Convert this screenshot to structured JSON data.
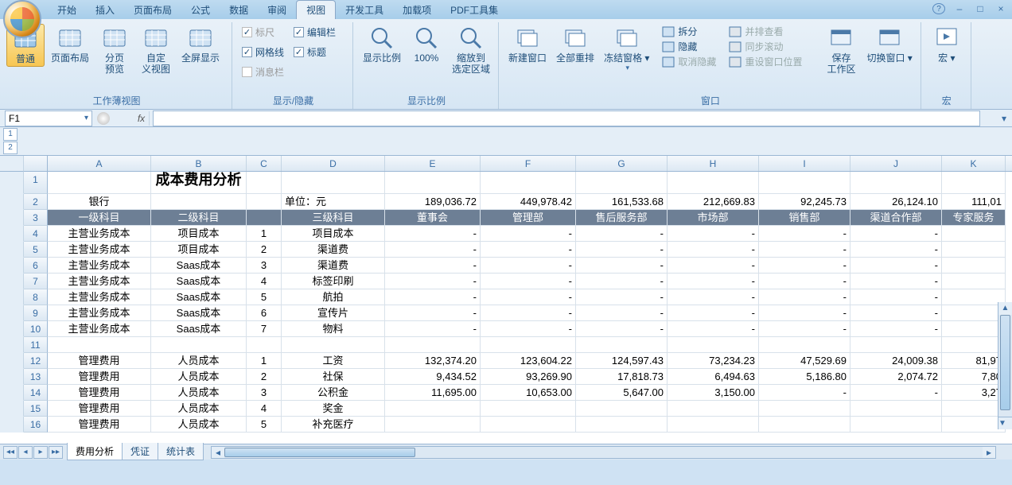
{
  "tabs": [
    "开始",
    "插入",
    "页面布局",
    "公式",
    "数据",
    "审阅",
    "视图",
    "开发工具",
    "加载项",
    "PDF工具集"
  ],
  "active_tab_index": 6,
  "ribbon": {
    "g1": {
      "label": "工作薄视图",
      "btns": [
        "普通",
        "页面布局",
        "分页\n预览",
        "自定\n义视图",
        "全屏显示"
      ]
    },
    "g2": {
      "label": "显示/隐藏",
      "chks": [
        {
          "label": "标尺",
          "checked": true,
          "disabled": true
        },
        {
          "label": "编辑栏",
          "checked": true
        },
        {
          "label": "网格线",
          "checked": true
        },
        {
          "label": "标题",
          "checked": true
        },
        {
          "label": "消息栏",
          "checked": false,
          "disabled": true
        }
      ]
    },
    "g3": {
      "label": "显示比例",
      "btns": [
        "显示比例",
        "100%",
        "缩放到\n选定区域"
      ]
    },
    "g4": {
      "label": "窗口",
      "big": [
        "新建窗口",
        "全部重排",
        "冻结窗格"
      ],
      "small": [
        "拆分",
        "隐藏",
        "取消隐藏",
        "并排查看",
        "同步滚动",
        "重设窗口位置"
      ],
      "right": [
        "保存\n工作区",
        "切换窗口"
      ]
    },
    "g5": {
      "label": "宏",
      "btn": "宏"
    }
  },
  "namebox": "F1",
  "columns": [
    "A",
    "B",
    "C",
    "D",
    "E",
    "F",
    "G",
    "H",
    "I",
    "J",
    "K"
  ],
  "outline_levels": [
    "1",
    "2"
  ],
  "rows": [
    {
      "n": 1,
      "cells": {
        "B": {
          "v": "成本费用分析",
          "cls": "title-cell center"
        }
      }
    },
    {
      "n": 2,
      "cells": {
        "A": {
          "v": "银行",
          "cls": "center"
        },
        "D": {
          "v": "单位：元"
        },
        "E": {
          "v": "189,036.72",
          "cls": "right"
        },
        "F": {
          "v": "449,978.42",
          "cls": "right"
        },
        "G": {
          "v": "161,533.68",
          "cls": "right"
        },
        "H": {
          "v": "212,669.83",
          "cls": "right"
        },
        "I": {
          "v": "92,245.73",
          "cls": "right"
        },
        "J": {
          "v": "26,124.10",
          "cls": "right"
        },
        "K": {
          "v": "111,01",
          "cls": "right"
        }
      }
    },
    {
      "n": 3,
      "hdr": true,
      "cells": {
        "A": {
          "v": "一级科目"
        },
        "B": {
          "v": "二级科目"
        },
        "D": {
          "v": "三级科目"
        },
        "E": {
          "v": "董事会"
        },
        "F": {
          "v": "管理部"
        },
        "G": {
          "v": "售后服务部"
        },
        "H": {
          "v": "市场部"
        },
        "I": {
          "v": "销售部"
        },
        "J": {
          "v": "渠道合作部"
        },
        "K": {
          "v": "专家服务"
        }
      }
    },
    {
      "n": 4,
      "cells": {
        "A": {
          "v": "主营业务成本",
          "cls": "center"
        },
        "B": {
          "v": "项目成本",
          "cls": "center"
        },
        "C": {
          "v": "1",
          "cls": "center"
        },
        "D": {
          "v": "项目成本",
          "cls": "center"
        },
        "E": {
          "v": "-",
          "cls": "right"
        },
        "F": {
          "v": "-",
          "cls": "right"
        },
        "G": {
          "v": "-",
          "cls": "right"
        },
        "H": {
          "v": "-",
          "cls": "right"
        },
        "I": {
          "v": "-",
          "cls": "right"
        },
        "J": {
          "v": "-",
          "cls": "right"
        }
      }
    },
    {
      "n": 5,
      "cells": {
        "A": {
          "v": "主营业务成本",
          "cls": "center"
        },
        "B": {
          "v": "项目成本",
          "cls": "center"
        },
        "C": {
          "v": "2",
          "cls": "center"
        },
        "D": {
          "v": "渠道费",
          "cls": "center"
        },
        "E": {
          "v": "-",
          "cls": "right"
        },
        "F": {
          "v": "-",
          "cls": "right"
        },
        "G": {
          "v": "-",
          "cls": "right"
        },
        "H": {
          "v": "-",
          "cls": "right"
        },
        "I": {
          "v": "-",
          "cls": "right"
        },
        "J": {
          "v": "-",
          "cls": "right"
        }
      }
    },
    {
      "n": 6,
      "cells": {
        "A": {
          "v": "主营业务成本",
          "cls": "center"
        },
        "B": {
          "v": "Saas成本",
          "cls": "center"
        },
        "C": {
          "v": "3",
          "cls": "center"
        },
        "D": {
          "v": "渠道费",
          "cls": "center"
        },
        "E": {
          "v": "-",
          "cls": "right"
        },
        "F": {
          "v": "-",
          "cls": "right"
        },
        "G": {
          "v": "-",
          "cls": "right"
        },
        "H": {
          "v": "-",
          "cls": "right"
        },
        "I": {
          "v": "-",
          "cls": "right"
        },
        "J": {
          "v": "-",
          "cls": "right"
        }
      }
    },
    {
      "n": 7,
      "cells": {
        "A": {
          "v": "主营业务成本",
          "cls": "center"
        },
        "B": {
          "v": "Saas成本",
          "cls": "center"
        },
        "C": {
          "v": "4",
          "cls": "center"
        },
        "D": {
          "v": "标签印刷",
          "cls": "center"
        },
        "E": {
          "v": "-",
          "cls": "right"
        },
        "F": {
          "v": "-",
          "cls": "right"
        },
        "G": {
          "v": "-",
          "cls": "right"
        },
        "H": {
          "v": "-",
          "cls": "right"
        },
        "I": {
          "v": "-",
          "cls": "right"
        },
        "J": {
          "v": "-",
          "cls": "right"
        }
      }
    },
    {
      "n": 8,
      "cells": {
        "A": {
          "v": "主营业务成本",
          "cls": "center"
        },
        "B": {
          "v": "Saas成本",
          "cls": "center"
        },
        "C": {
          "v": "5",
          "cls": "center"
        },
        "D": {
          "v": "航拍",
          "cls": "center"
        },
        "E": {
          "v": "-",
          "cls": "right"
        },
        "F": {
          "v": "-",
          "cls": "right"
        },
        "G": {
          "v": "-",
          "cls": "right"
        },
        "H": {
          "v": "-",
          "cls": "right"
        },
        "I": {
          "v": "-",
          "cls": "right"
        },
        "J": {
          "v": "-",
          "cls": "right"
        }
      }
    },
    {
      "n": 9,
      "cells": {
        "A": {
          "v": "主营业务成本",
          "cls": "center"
        },
        "B": {
          "v": "Saas成本",
          "cls": "center"
        },
        "C": {
          "v": "6",
          "cls": "center"
        },
        "D": {
          "v": "宣传片",
          "cls": "center"
        },
        "E": {
          "v": "-",
          "cls": "right"
        },
        "F": {
          "v": "-",
          "cls": "right"
        },
        "G": {
          "v": "-",
          "cls": "right"
        },
        "H": {
          "v": "-",
          "cls": "right"
        },
        "I": {
          "v": "-",
          "cls": "right"
        },
        "J": {
          "v": "-",
          "cls": "right"
        }
      }
    },
    {
      "n": 10,
      "cells": {
        "A": {
          "v": "主营业务成本",
          "cls": "center"
        },
        "B": {
          "v": "Saas成本",
          "cls": "center"
        },
        "C": {
          "v": "7",
          "cls": "center"
        },
        "D": {
          "v": "物料",
          "cls": "center"
        },
        "E": {
          "v": "-",
          "cls": "right"
        },
        "F": {
          "v": "-",
          "cls": "right"
        },
        "G": {
          "v": "-",
          "cls": "right"
        },
        "H": {
          "v": "-",
          "cls": "right"
        },
        "I": {
          "v": "-",
          "cls": "right"
        },
        "J": {
          "v": "-",
          "cls": "right"
        }
      }
    },
    {
      "n": 11,
      "cells": {}
    },
    {
      "n": 12,
      "cells": {
        "A": {
          "v": "管理费用",
          "cls": "center"
        },
        "B": {
          "v": "人员成本",
          "cls": "center"
        },
        "C": {
          "v": "1",
          "cls": "center"
        },
        "D": {
          "v": "工资",
          "cls": "center"
        },
        "E": {
          "v": "132,374.20",
          "cls": "right"
        },
        "F": {
          "v": "123,604.22",
          "cls": "right"
        },
        "G": {
          "v": "124,597.43",
          "cls": "right"
        },
        "H": {
          "v": "73,234.23",
          "cls": "right"
        },
        "I": {
          "v": "47,529.69",
          "cls": "right"
        },
        "J": {
          "v": "24,009.38",
          "cls": "right"
        },
        "K": {
          "v": "81,97",
          "cls": "right"
        }
      }
    },
    {
      "n": 13,
      "cells": {
        "A": {
          "v": "管理费用",
          "cls": "center"
        },
        "B": {
          "v": "人员成本",
          "cls": "center"
        },
        "C": {
          "v": "2",
          "cls": "center"
        },
        "D": {
          "v": "社保",
          "cls": "center"
        },
        "E": {
          "v": "9,434.52",
          "cls": "right"
        },
        "F": {
          "v": "93,269.90",
          "cls": "right"
        },
        "G": {
          "v": "17,818.73",
          "cls": "right"
        },
        "H": {
          "v": "6,494.63",
          "cls": "right"
        },
        "I": {
          "v": "5,186.80",
          "cls": "right"
        },
        "J": {
          "v": "2,074.72",
          "cls": "right"
        },
        "K": {
          "v": "7,80",
          "cls": "right"
        }
      }
    },
    {
      "n": 14,
      "cells": {
        "A": {
          "v": "管理费用",
          "cls": "center"
        },
        "B": {
          "v": "人员成本",
          "cls": "center"
        },
        "C": {
          "v": "3",
          "cls": "center"
        },
        "D": {
          "v": "公积金",
          "cls": "center"
        },
        "E": {
          "v": "11,695.00",
          "cls": "right"
        },
        "F": {
          "v": "10,653.00",
          "cls": "right"
        },
        "G": {
          "v": "5,647.00",
          "cls": "right"
        },
        "H": {
          "v": "3,150.00",
          "cls": "right"
        },
        "I": {
          "v": "-",
          "cls": "right"
        },
        "J": {
          "v": "-",
          "cls": "right"
        },
        "K": {
          "v": "3,27",
          "cls": "right"
        }
      }
    },
    {
      "n": 15,
      "cells": {
        "A": {
          "v": "管理费用",
          "cls": "center"
        },
        "B": {
          "v": "人员成本",
          "cls": "center"
        },
        "C": {
          "v": "4",
          "cls": "center"
        },
        "D": {
          "v": "奖金",
          "cls": "center"
        }
      }
    },
    {
      "n": 16,
      "cells": {
        "A": {
          "v": "管理费用",
          "cls": "center"
        },
        "B": {
          "v": "人员成本",
          "cls": "center"
        },
        "C": {
          "v": "5",
          "cls": "center"
        },
        "D": {
          "v": "补充医疗",
          "cls": "center"
        }
      }
    }
  ],
  "sheet_tabs": [
    "费用分析",
    "凭证",
    "统计表"
  ],
  "active_sheet": 0
}
